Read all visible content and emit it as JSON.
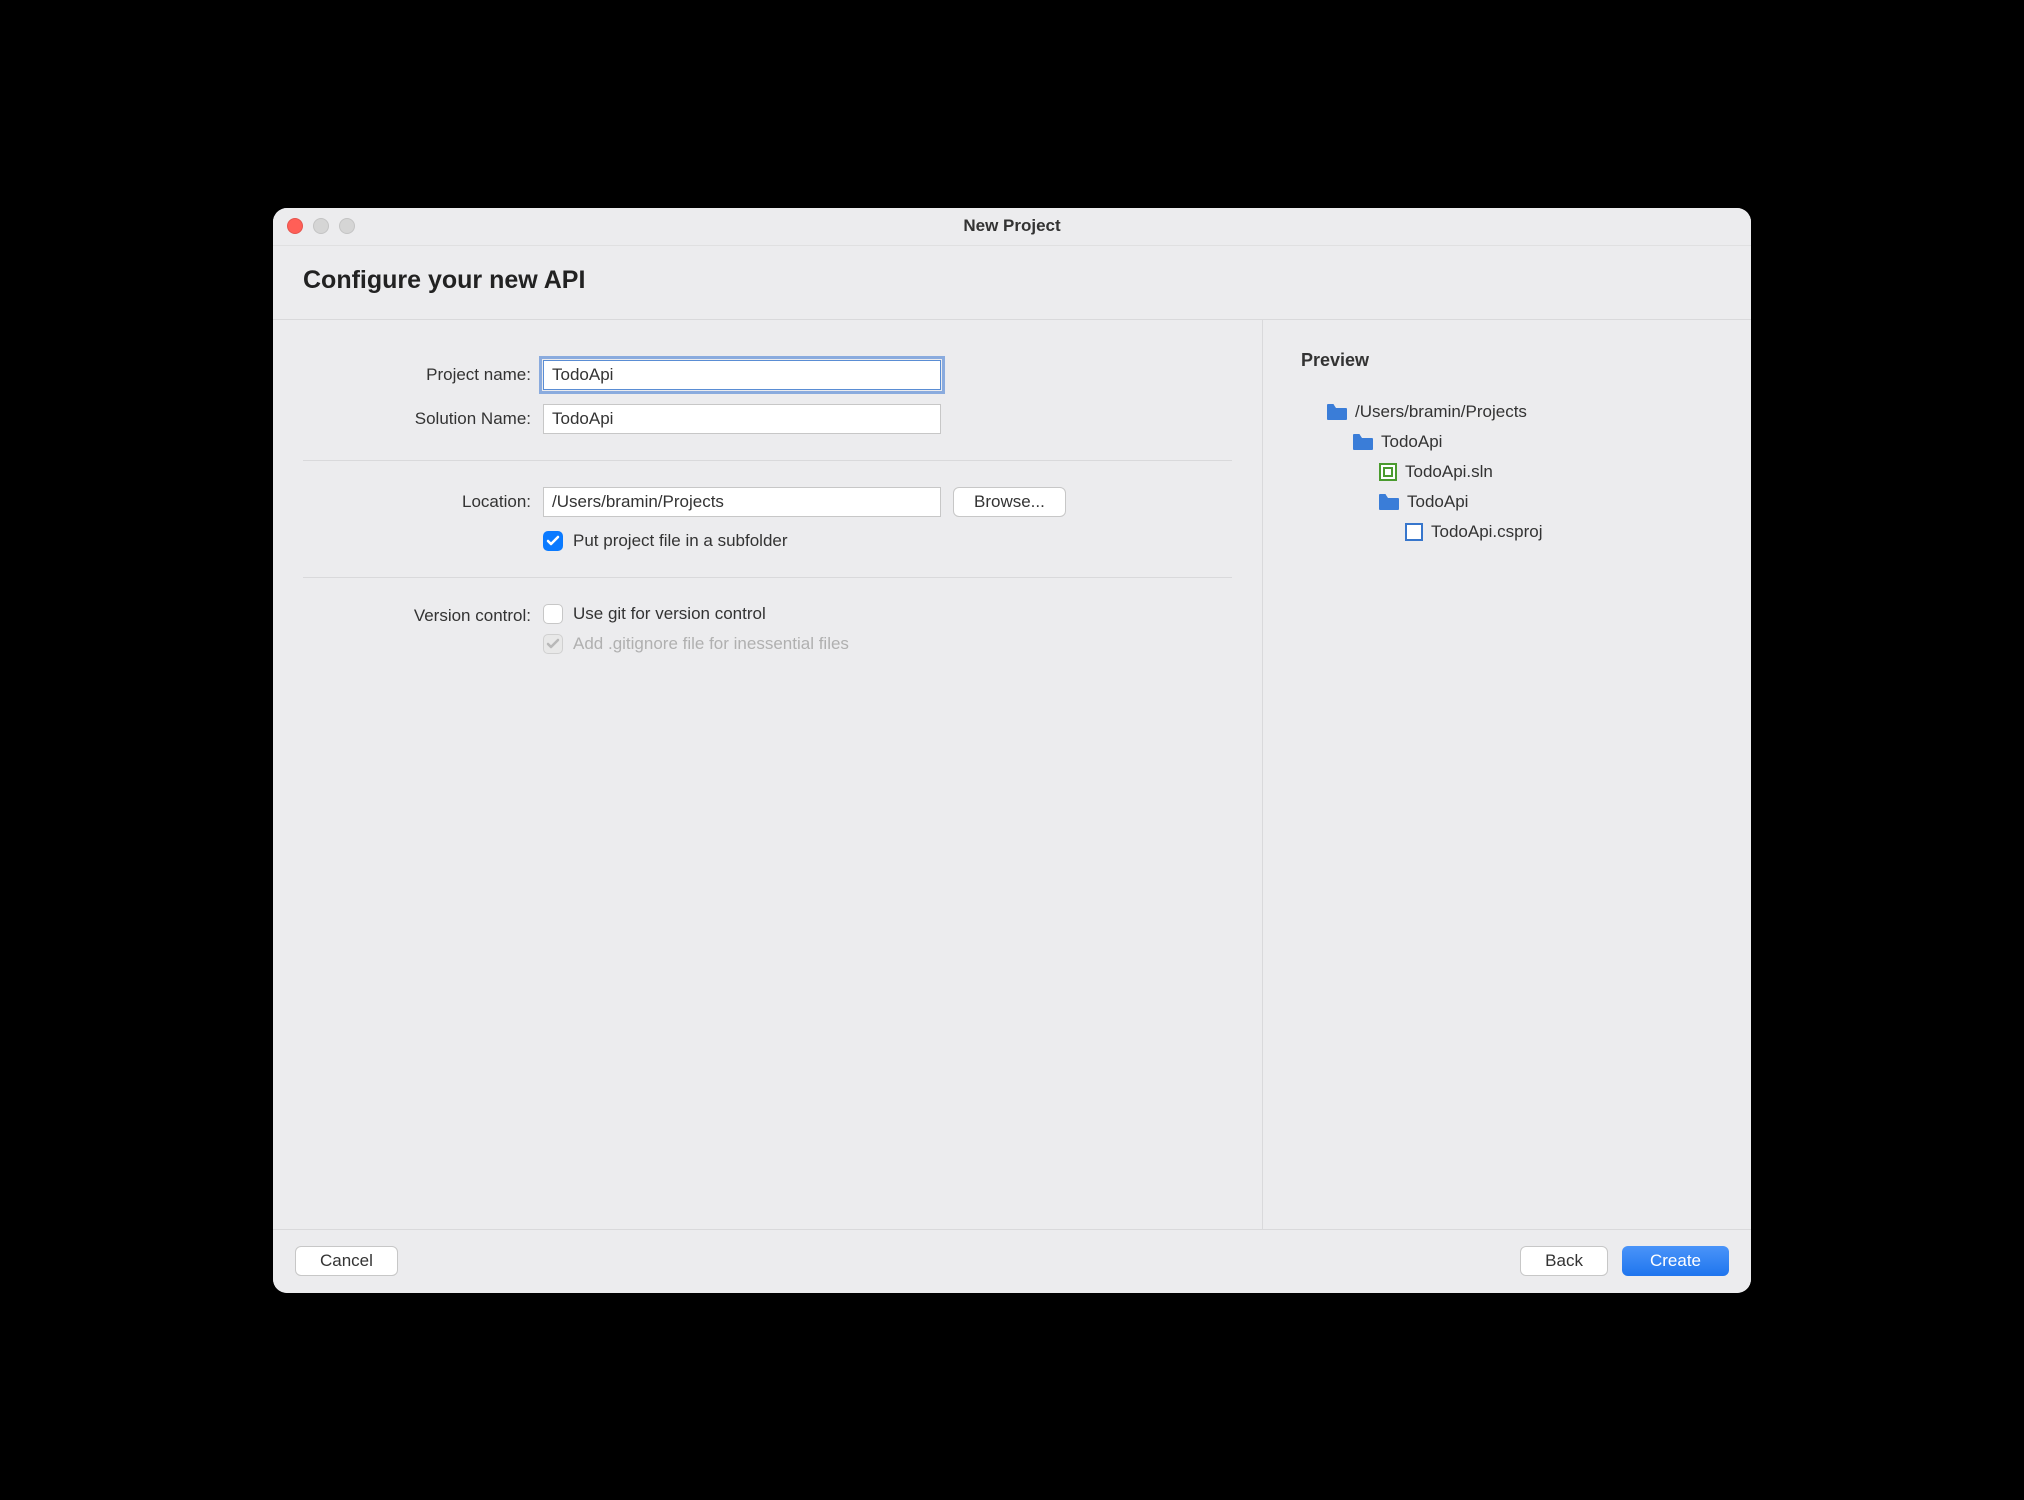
{
  "window": {
    "title": "New Project"
  },
  "header": {
    "title": "Configure your new API"
  },
  "form": {
    "project_name_label": "Project name:",
    "project_name_value": "TodoApi",
    "solution_name_label": "Solution Name:",
    "solution_name_value": "TodoApi",
    "location_label": "Location:",
    "location_value": "/Users/bramin/Projects",
    "browse_label": "Browse...",
    "subfolder_label": "Put project file in a subfolder",
    "subfolder_checked": true,
    "version_control_label": "Version control:",
    "git_label": "Use git for version control",
    "git_checked": false,
    "gitignore_label": "Add .gitignore file for inessential files",
    "gitignore_checked": true
  },
  "preview": {
    "title": "Preview",
    "tree": {
      "root": "/Users/bramin/Projects",
      "folder1": "TodoApi",
      "sln": "TodoApi.sln",
      "folder2": "TodoApi",
      "csproj": "TodoApi.csproj"
    }
  },
  "footer": {
    "cancel": "Cancel",
    "back": "Back",
    "create": "Create"
  }
}
